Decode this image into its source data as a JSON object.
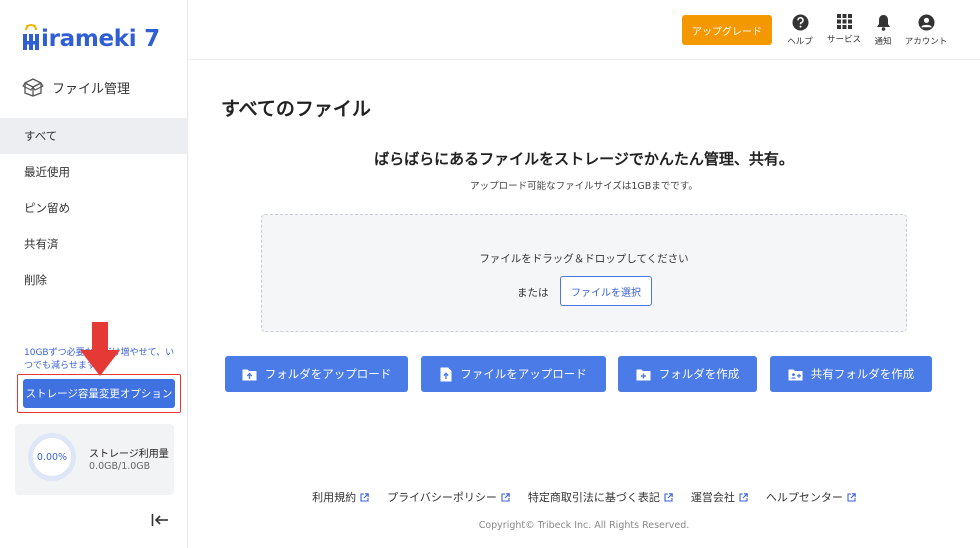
{
  "brand": {
    "logo_text": "irameki 7",
    "accent": "#2f5fd3"
  },
  "sidebar": {
    "section_title": "ファイル管理",
    "items": [
      {
        "label": "すべて",
        "active": true
      },
      {
        "label": "最近使用"
      },
      {
        "label": "ピン留め"
      },
      {
        "label": "共有済"
      },
      {
        "label": "削除"
      }
    ],
    "promo_text": "10GBずつ必要な分だけ増やせて、いつでも減らせます。",
    "storage_button": "ストレージ容量変更オプション",
    "usage": {
      "percent": "0.00%",
      "title": "ストレージ利用量",
      "value": "0.0GB/1.0GB"
    }
  },
  "header": {
    "upgrade": "アップグレード",
    "icons": [
      {
        "name": "help-icon",
        "label": "ヘルプ"
      },
      {
        "name": "services-icon",
        "label": "サービス"
      },
      {
        "name": "bell-icon",
        "label": "通知"
      },
      {
        "name": "account-icon",
        "label": "アカウント"
      }
    ]
  },
  "main": {
    "title": "すべてのファイル",
    "hero_title": "ばらばらにあるファイルをストレージでかんたん管理、共有。",
    "hero_sub": "アップロード可能なファイルサイズは1GBまでです。",
    "dropzone_text": "ファイルをドラッグ＆ドロップしてください",
    "or_text": "または",
    "select_file": "ファイルを選択",
    "actions": [
      {
        "label": "フォルダをアップロード",
        "icon": "folder-upload-icon"
      },
      {
        "label": "ファイルをアップロード",
        "icon": "file-upload-icon"
      },
      {
        "label": "フォルダを作成",
        "icon": "folder-add-icon"
      },
      {
        "label": "共有フォルダを作成",
        "icon": "shared-folder-add-icon"
      }
    ]
  },
  "footer": {
    "links": [
      "利用規約",
      "プライバシーポリシー",
      "特定商取引法に基づく表記",
      "運営会社",
      "ヘルプセンター"
    ],
    "copyright": "Copyright© Tribeck Inc. All Rights Reserved."
  }
}
